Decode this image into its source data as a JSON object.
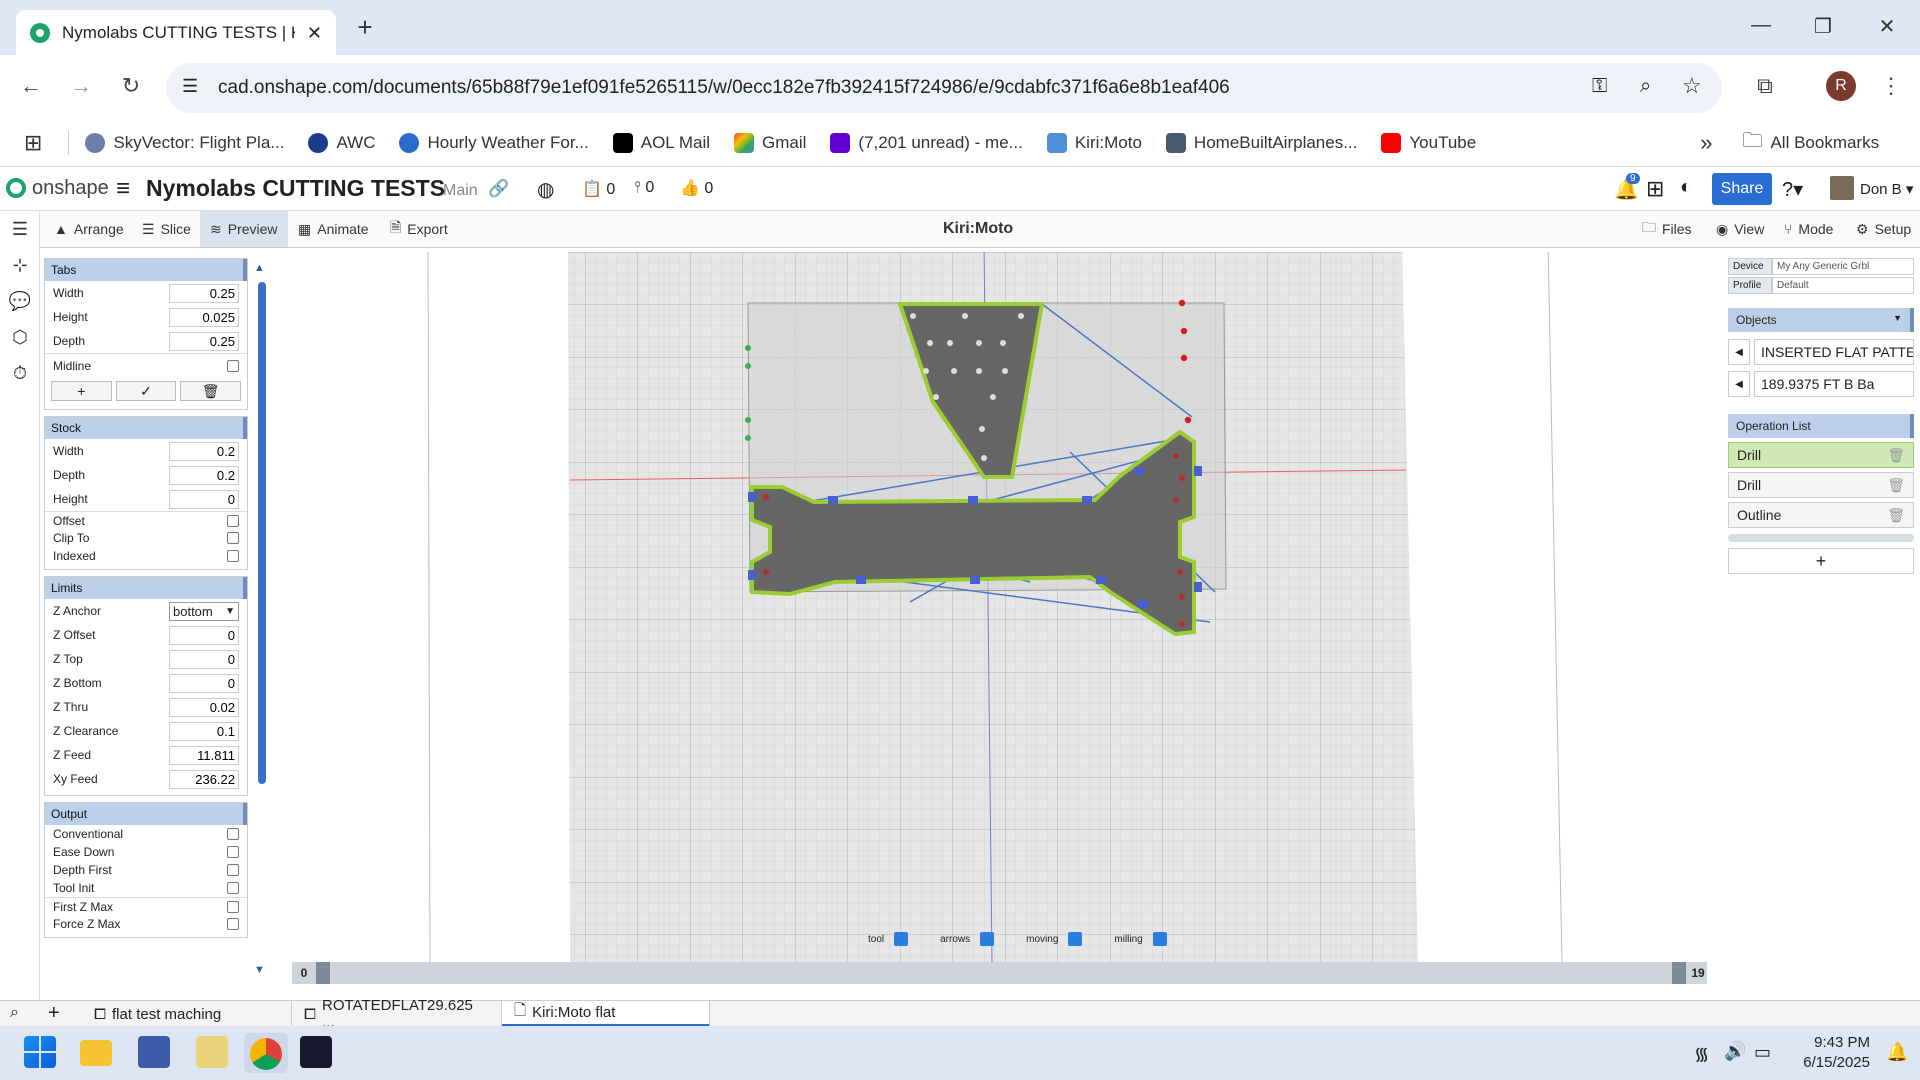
{
  "browser": {
    "tab_title": "Nymolabs CUTTING TESTS | Kiri:Moto",
    "new_tab": "+",
    "url": "cad.onshape.com/documents/65b88f79e1ef091fe5265115/w/0ecc182e7fb392415f724986/e/9cdabfc371f6a6e8b1eaf406",
    "profile_initial": "R",
    "bookmarks": [
      "SkyVector: Flight Pla...",
      "AWC",
      "Hourly Weather For...",
      "AOL Mail",
      "Gmail",
      "(7,201 unread) - me...",
      "Kiri:Moto",
      "HomeBuiltAirplanes...",
      "YouTube"
    ],
    "all_bookmarks": "All Bookmarks",
    "more": "»"
  },
  "onshape": {
    "logo": "onshape",
    "doc_title": "Nymolabs CUTTING TESTS",
    "branch": "Main",
    "counts": [
      "0",
      "0",
      "0"
    ],
    "notifications": "9",
    "share": "Share",
    "user": "Don B"
  },
  "kiri": {
    "toolbar": [
      "Arrange",
      "Slice",
      "Preview",
      "Animate",
      "Export"
    ],
    "title": "Kiri:Moto",
    "right_toolbar": [
      "Files",
      "View",
      "Mode",
      "Setup"
    ]
  },
  "left_panel": {
    "tabs": {
      "title": "Tabs",
      "fields": [
        {
          "label": "Width",
          "value": "0.25"
        },
        {
          "label": "Height",
          "value": "0.025"
        },
        {
          "label": "Depth",
          "value": "0.25"
        }
      ],
      "midline": "Midline"
    },
    "stock": {
      "title": "Stock",
      "fields": [
        {
          "label": "Width",
          "value": "0.2"
        },
        {
          "label": "Depth",
          "value": "0.2"
        },
        {
          "label": "Height",
          "value": "0"
        }
      ],
      "checks": [
        "Offset",
        "Clip To",
        "Indexed"
      ]
    },
    "limits": {
      "title": "Limits",
      "z_anchor_label": "Z Anchor",
      "z_anchor_value": "bottom",
      "fields": [
        {
          "label": "Z Offset",
          "value": "0"
        },
        {
          "label": "Z Top",
          "value": "0"
        },
        {
          "label": "Z Bottom",
          "value": "0"
        },
        {
          "label": "Z Thru",
          "value": "0.02"
        },
        {
          "label": "Z Clearance",
          "value": "0.1"
        },
        {
          "label": "Z Feed",
          "value": "11.811"
        },
        {
          "label": "Xy Feed",
          "value": "236.22"
        }
      ]
    },
    "output": {
      "title": "Output",
      "checks1": [
        "Conventional",
        "Ease Down",
        "Depth First",
        "Tool Init"
      ],
      "checks2": [
        "First Z Max",
        "Force Z Max"
      ]
    }
  },
  "right_panel": {
    "device_label": "Device",
    "device_value": "My Any Generic Grbl",
    "profile_label": "Profile",
    "profile_value": "Default",
    "objects_title": "Objects",
    "objects": [
      "INSERTED FLAT PATTERN",
      "189.9375 FT B Ba"
    ],
    "operation_title": "Operation List",
    "operations": [
      "Drill",
      "Drill",
      "Outline"
    ],
    "add": "+"
  },
  "viewport": {
    "toggles": [
      {
        "label": "tool",
        "checked": true
      },
      {
        "label": "arrows",
        "checked": true
      },
      {
        "label": "moving",
        "checked": true
      },
      {
        "label": "milling",
        "checked": true
      }
    ],
    "layer_min": "0",
    "layer_max": "19",
    "colors": {
      "part": "#6b6b6b",
      "outline": "#9acd32",
      "path": "#4a78c2",
      "drill": "#c0392b"
    }
  },
  "bottom_tabs": [
    "flat test maching",
    "ROTATEDFLAT29.625 ...",
    "Kiri:Moto flat"
  ],
  "taskbar": {
    "time": "9:43 PM",
    "date": "6/15/2025"
  }
}
